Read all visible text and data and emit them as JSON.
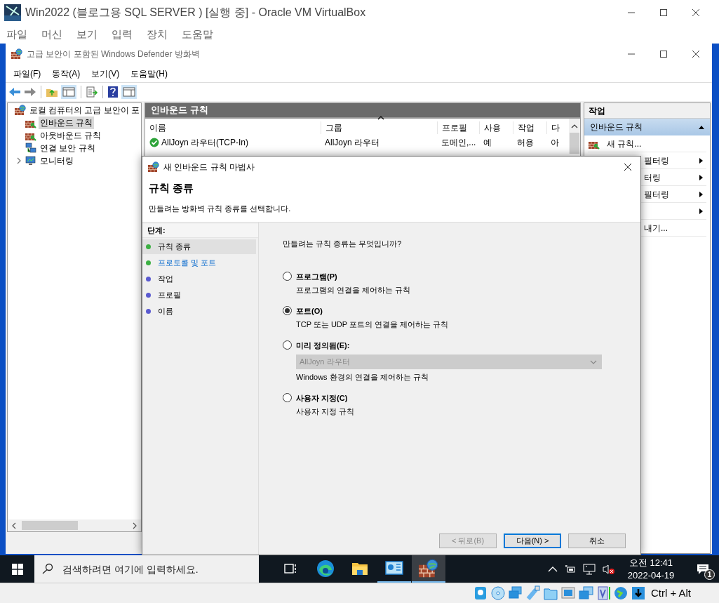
{
  "host_window": {
    "title": "Win2022 (블로그용 SQL SERVER ) [실행 중] - Oracle VM VirtualBox",
    "menu": [
      "파일",
      "머신",
      "보기",
      "입력",
      "장치",
      "도움말"
    ]
  },
  "mmc": {
    "title": "고급 보안이 포함된 Windows Defender 방화벽",
    "menu": [
      "파일(F)",
      "동작(A)",
      "보기(V)",
      "도움말(H)"
    ],
    "tree": [
      {
        "label": "로컬 컴퓨터의 고급 보안이 포",
        "kind": "root",
        "selected": false,
        "children": [
          {
            "label": "인바운드 규칙",
            "kind": "inbound",
            "selected": true
          },
          {
            "label": "아웃바운드 규칙",
            "kind": "outbound",
            "selected": false
          },
          {
            "label": "연결 보안 규칙",
            "kind": "connection",
            "selected": false
          },
          {
            "label": "모니터링",
            "kind": "monitor",
            "selected": false,
            "expanded": false
          }
        ]
      }
    ],
    "center": {
      "title": "인바운드 규칙",
      "columns": [
        "이름",
        "그룹",
        "프로필",
        "사용",
        "작업",
        "다"
      ],
      "rows": [
        {
          "enabled": true,
          "cells": [
            "AllJoyn 라우터(TCP-In)",
            "AllJoyn 라우터",
            "도메인,...",
            "예",
            "허용",
            "아"
          ]
        }
      ]
    },
    "actions": {
      "title": "작업",
      "section": {
        "title": "인바운드 규칙",
        "expanded": true
      },
      "items": [
        {
          "kind": "new",
          "label": "새 규칙..."
        },
        {
          "kind": "submenu",
          "label": "필터링"
        },
        {
          "kind": "submenu",
          "label": "터링"
        },
        {
          "kind": "submenu",
          "label": "필터링"
        },
        {
          "kind": "submenu"
        },
        {
          "kind": "plain",
          "label": "내기..."
        }
      ]
    }
  },
  "wizard": {
    "title": "새 인바운드 규칙 마법사",
    "heading": "규칙 종류",
    "subtitle": "만들려는 방화벽 규칙 종류를 선택합니다.",
    "steps_label": "단계:",
    "steps": [
      {
        "label": "규칙 종류",
        "color": "#3cb043",
        "selected": true,
        "kind": "text"
      },
      {
        "label": "프로토콜 및 포트",
        "color": "#3cb043",
        "selected": false,
        "kind": "link"
      },
      {
        "label": "작업",
        "color": "#5a5ad0",
        "selected": false,
        "kind": "text"
      },
      {
        "label": "프로필",
        "color": "#5a5ad0",
        "selected": false,
        "kind": "text"
      },
      {
        "label": "이름",
        "color": "#5a5ad0",
        "selected": false,
        "kind": "text"
      }
    ],
    "question": "만들려는 규칙 종류는 무엇입니까?",
    "options": [
      {
        "kind": "plain",
        "label": "프로그램(P)",
        "description": "프로그램의 연결을 제어하는 규칙",
        "selected": false
      },
      {
        "kind": "plain",
        "label": "포트(O)",
        "description": "TCP 또는 UDP 포트의 연결을 제어하는 규칙",
        "selected": true
      },
      {
        "kind": "dropdown",
        "label": "미리 정의됨(E):",
        "dropdown": {
          "value": "AllJoyn 라우터",
          "disabled": true
        },
        "description": "Windows 환경의 연결을 제어하는 규칙",
        "selected": false
      },
      {
        "kind": "plain",
        "label": "사용자 지정(C)",
        "description": "사용자 지정 규칙",
        "selected": false
      }
    ],
    "buttons": [
      {
        "label": "< 뒤로(B)",
        "disabled": true,
        "focused": false
      },
      {
        "label": "다음(N) >",
        "disabled": false,
        "focused": true
      },
      {
        "label": "취소",
        "disabled": false,
        "focused": false
      }
    ]
  },
  "taskbar": {
    "search": {
      "placeholder": "검색하려면 여기에 입력하세요."
    },
    "apps": [
      {
        "kind": "taskview",
        "selected": false
      },
      {
        "kind": "edge",
        "selected": false
      },
      {
        "kind": "explorer",
        "selected": false
      },
      {
        "kind": "servermanager",
        "selected": false
      },
      {
        "kind": "firewall",
        "selected": true
      }
    ],
    "clock": {
      "time": "오전 12:41",
      "date": "2022-04-19"
    },
    "notifications": "1"
  },
  "status_bar": {
    "hostkey": "Ctrl + Alt"
  }
}
